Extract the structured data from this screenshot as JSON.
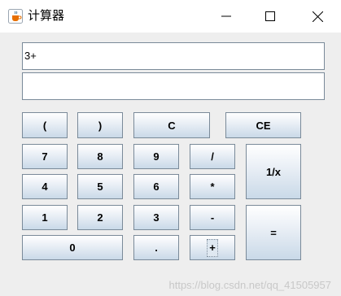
{
  "window": {
    "title": "计算器",
    "icon": "java-cup-icon"
  },
  "display": {
    "expression": "3+",
    "result": ""
  },
  "buttons": {
    "lparen": "(",
    "rparen": ")",
    "clear": "C",
    "clear_entry": "CE",
    "seven": "7",
    "eight": "8",
    "nine": "9",
    "divide": "/",
    "reciprocal": "1/x",
    "four": "4",
    "five": "5",
    "six": "6",
    "multiply": "*",
    "one": "1",
    "two": "2",
    "three": "3",
    "minus": "-",
    "equals": "=",
    "zero": "0",
    "dot": ".",
    "plus": "+"
  },
  "watermark": "https://blog.csdn.net/qq_41505957"
}
